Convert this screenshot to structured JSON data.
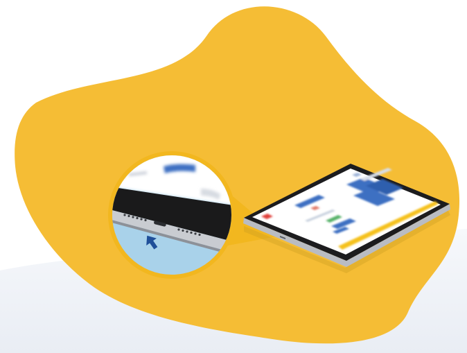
{
  "colors": {
    "background": "#ffffff",
    "floor": "#eef1f6",
    "blob": "#f5bd35",
    "ring": "#f2b71f",
    "tablet_frame": "#1c1c1e",
    "tablet_screen": "#ffffff",
    "screen_button": "#3d6fc2",
    "screen_accent_bar": "#f5c11c",
    "callout_surface": "#a9d2ea",
    "arrow": "#1f4f99"
  },
  "icons": {
    "pointer": "arrow-icon",
    "port": "charging-port-icon"
  }
}
